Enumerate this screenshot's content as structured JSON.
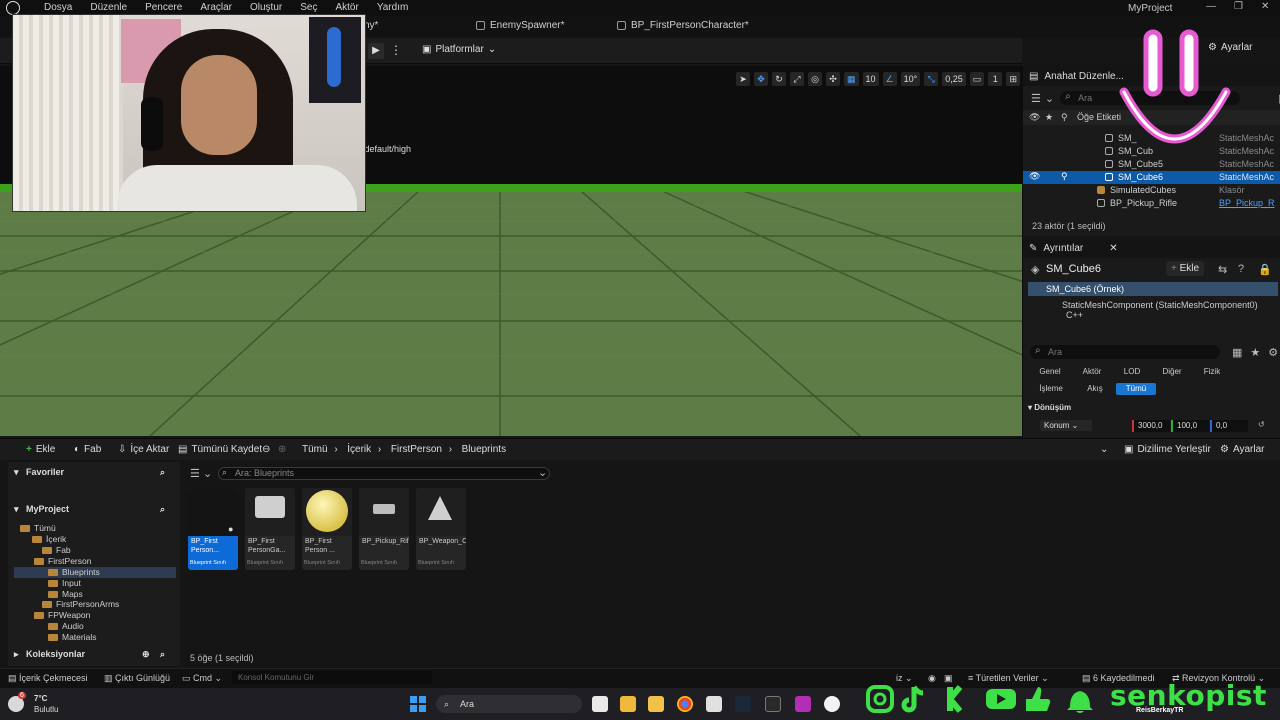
{
  "menubar": {
    "items": [
      "Dosya",
      "Düzenle",
      "Pencere",
      "Araçlar",
      "Oluştur",
      "Seç",
      "Aktör",
      "Yardım"
    ],
    "project": "MyProject"
  },
  "tabs": [
    {
      "label": "ny*"
    },
    {
      "label": "EnemySpawner*"
    },
    {
      "label": "BP_FirstPersonCharacter*"
    }
  ],
  "toolbar": {
    "platforms": "Platformlar",
    "settings": "Ayarlar"
  },
  "viewport": {
    "hint": "/default/high",
    "tools": {
      "grid": "10",
      "rotation": "10°",
      "scale": "0,25",
      "camera": "1"
    }
  },
  "outliner": {
    "tab": "Anahat Düzenle...",
    "search_placeholder": "Ara",
    "column_label": "Öğe Etiketi",
    "rows": [
      {
        "name": "SM_",
        "type": "StaticMeshAc"
      },
      {
        "name": "SM_Cub",
        "type": "StaticMeshAc"
      },
      {
        "name": "SM_Cube5",
        "type": "StaticMeshAc"
      },
      {
        "name": "SM_Cube6",
        "type": "StaticMeshAc"
      },
      {
        "name": "SimulatedCubes",
        "type": "Klasör"
      },
      {
        "name": "BP_Pickup_Rifle",
        "type": "BP_Pickup_R"
      }
    ],
    "count": "23 aktör (1 seçildi)"
  },
  "details": {
    "tab": "Ayrıntılar",
    "title": "SM_Cube6",
    "add": "Ekle",
    "selected": "SM_Cube6 (Örnek)",
    "component": "StaticMeshComponent (StaticMeshComponent0)",
    "component_suffix": "C++",
    "search_placeholder": "Ara",
    "filters_row1": [
      "Genel",
      "Aktör",
      "LOD",
      "Diğer",
      "Fizik"
    ],
    "filters_row2": [
      "İşleme",
      "Akış",
      "Tümü"
    ],
    "section": "Dönüşüm",
    "location_label": "Konum",
    "location_values": [
      "3000,0",
      "100,0",
      "0,0"
    ]
  },
  "content_browser": {
    "toolbar": {
      "add": "Ekle",
      "fab": "Fab",
      "import": "İçe Aktar",
      "save_all": "Tümünü Kaydet",
      "dock": "Dizilime Yerleştir",
      "settings": "Ayarlar"
    },
    "breadcrumb": [
      "Tümü",
      "İçerik",
      "FirstPerson",
      "Blueprints"
    ],
    "search_placeholder": "Ara: Blueprints",
    "favorites": "Favoriler",
    "project": "MyProject",
    "collections": "Koleksiyonlar",
    "tree": [
      {
        "name": "Tümü",
        "depth": 0
      },
      {
        "name": "İçerik",
        "depth": 1
      },
      {
        "name": "Fab",
        "depth": 2
      },
      {
        "name": "FirstPerson",
        "depth": 2
      },
      {
        "name": "Blueprints",
        "depth": 3
      },
      {
        "name": "Input",
        "depth": 3
      },
      {
        "name": "Maps",
        "depth": 3
      },
      {
        "name": "FirstPersonArms",
        "depth": 2
      },
      {
        "name": "FPWeapon",
        "depth": 2
      },
      {
        "name": "Audio",
        "depth": 3
      },
      {
        "name": "Materials",
        "depth": 3
      }
    ],
    "assets": [
      {
        "name": "BP_First Person...",
        "type": "Blueprint Sınıfı",
        "thumb": "dark-character"
      },
      {
        "name": "BP_First PersonGa...",
        "type": "Blueprint Sınıfı",
        "thumb": "monitor-gamemode"
      },
      {
        "name": "BP_First Person ...",
        "type": "Blueprint Sınıfı",
        "thumb": "yellow-sphere"
      },
      {
        "name": "BP_Pickup_Rifle",
        "type": "Blueprint Sınıfı",
        "thumb": "rifle"
      },
      {
        "name": "BP_Weapon_Component",
        "type": "Blueprint Sınıfı",
        "thumb": "component"
      }
    ],
    "item_count": "5 öğe (1 seçildi)"
  },
  "statusbar": {
    "drawer": "İçerik Çekmecesi",
    "log": "Çıktı Günlüğü",
    "cmd": "Cmd",
    "console_placeholder": "Konsol Komutunu Gir",
    "derived": "Türetilen Veriler",
    "saved": "6 Kaydedilmedi",
    "revision": "Revizyon Kontrolü",
    "misc": "iz"
  },
  "taskbar": {
    "temp": "7°C",
    "weather": "Bulutlu",
    "badge": "6",
    "search": "Ara",
    "username": "ReisBerkayTR"
  },
  "overlay": {
    "brand": "senkopist"
  },
  "colors": {
    "accent": "#0d6ad6",
    "brand": "#3ee048",
    "smiley": "#e85ad2",
    "horizon": "#3ea11c"
  }
}
